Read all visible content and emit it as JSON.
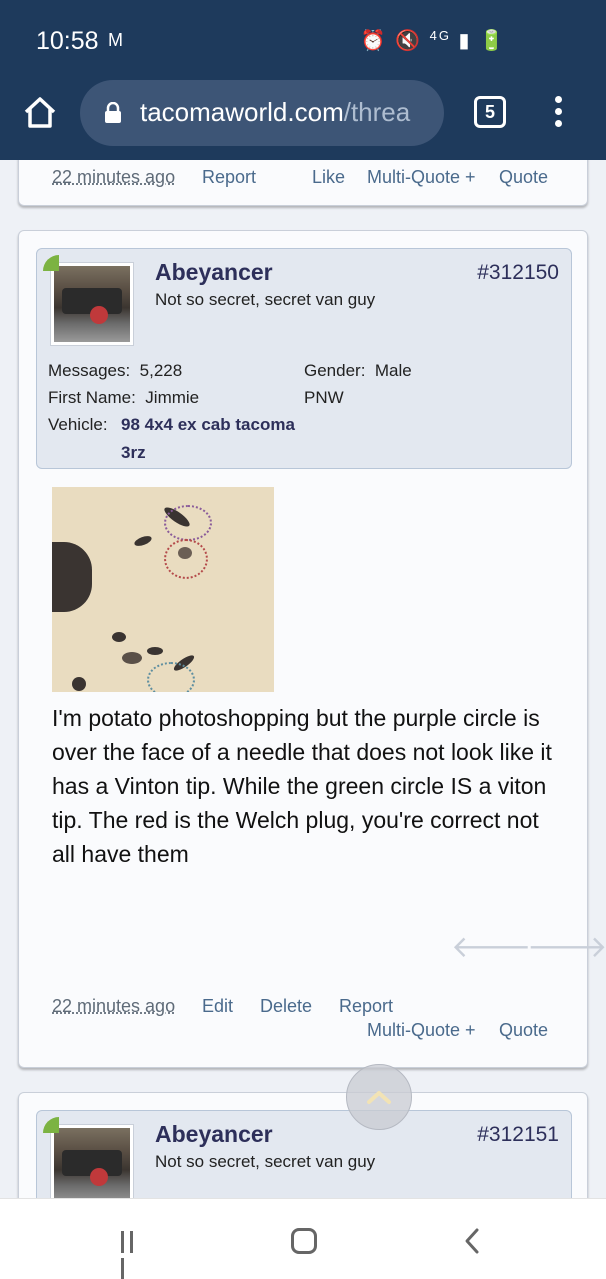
{
  "status_bar": {
    "time": "10:58",
    "notification_icon": "gmail-m-icon",
    "icons": [
      "alarm-icon",
      "mute-icon",
      "4g-lte-icon",
      "signal-icon",
      "battery-charging-icon"
    ],
    "network": "4G"
  },
  "browser": {
    "url_host": "tacomaworld.com",
    "url_path": "/threa",
    "tab_count": "5"
  },
  "prev_post": {
    "time": "22 minutes ago",
    "report": "Report",
    "like": "Like",
    "multi_quote": "Multi-Quote +",
    "quote": "Quote"
  },
  "post": {
    "username": "Abeyancer",
    "user_title": "Not so secret, secret van guy",
    "post_number": "#312150",
    "messages_label": "Messages:",
    "messages_value": "5,228",
    "gender_label": "Gender:",
    "gender_value": "Male",
    "first_name_label": "First Name:",
    "first_name_value": "Jimmie",
    "location": "PNW",
    "vehicle_label": "Vehicle:",
    "vehicle_line1": "98 4x4 ex cab tacoma",
    "vehicle_line2": "3rz",
    "body": "I'm potato photoshopping but the purple circle is over the face of a needle that does not look like it has a Vinton tip. While the green circle IS a viton tip. The red is the Welch plug, you're correct not all have them",
    "time": "22 minutes ago",
    "edit": "Edit",
    "delete": "Delete",
    "report": "Report",
    "multi_quote": "Multi-Quote +",
    "quote": "Quote"
  },
  "next_post": {
    "username": "Abeyancer",
    "user_title": "Not so secret, secret van guy",
    "post_number": "#312151"
  },
  "colors": {
    "top_bar": "#1e3a5c",
    "username": "#2d2f5a",
    "link": "#4a6a8c",
    "online": "#7cb342"
  }
}
